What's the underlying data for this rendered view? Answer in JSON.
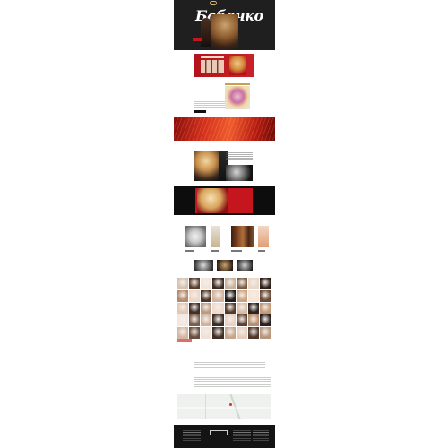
{
  "header": {
    "title": "Бабочко",
    "nav_items": [
      "",
      "",
      "",
      "",
      "",
      "",
      "",
      ""
    ]
  },
  "gallery": {
    "colors": [
      "#d6c1b0",
      "#5a3c2b",
      "#f1e4d9",
      "#3a2a22",
      "#c8b09a",
      "#7a5a44",
      "#e8d7c7",
      "#2c1f19",
      "#b48a6b",
      "#eed6c4",
      "#4a3326",
      "#d2b3a0",
      "#1e1b1a",
      "#caa27d",
      "#f5e5d8",
      "#6b4b39",
      "#e2c8b6",
      "#3f2f27",
      "#b99a84",
      "#efdccf",
      "#523a2d",
      "#d9bca6",
      "#2a2321",
      "#c49b7a",
      "#f3e7df",
      "#7b5d4b",
      "#cfb29c",
      "#3a2d25",
      "#e8d2c2",
      "#5c4134",
      "#b68d70",
      "#2b201b",
      "#d4b7a3",
      "#6a4f3f",
      "#f0e1d6",
      "#3d2e26",
      "#c7a58b",
      "#e5cdbc",
      "#4e382c",
      "#b7967f"
    ]
  },
  "colors": {
    "accent_gold": "#c9a04c",
    "accent_red": "#c4161c",
    "dark_bg": "#1f1f1f"
  }
}
